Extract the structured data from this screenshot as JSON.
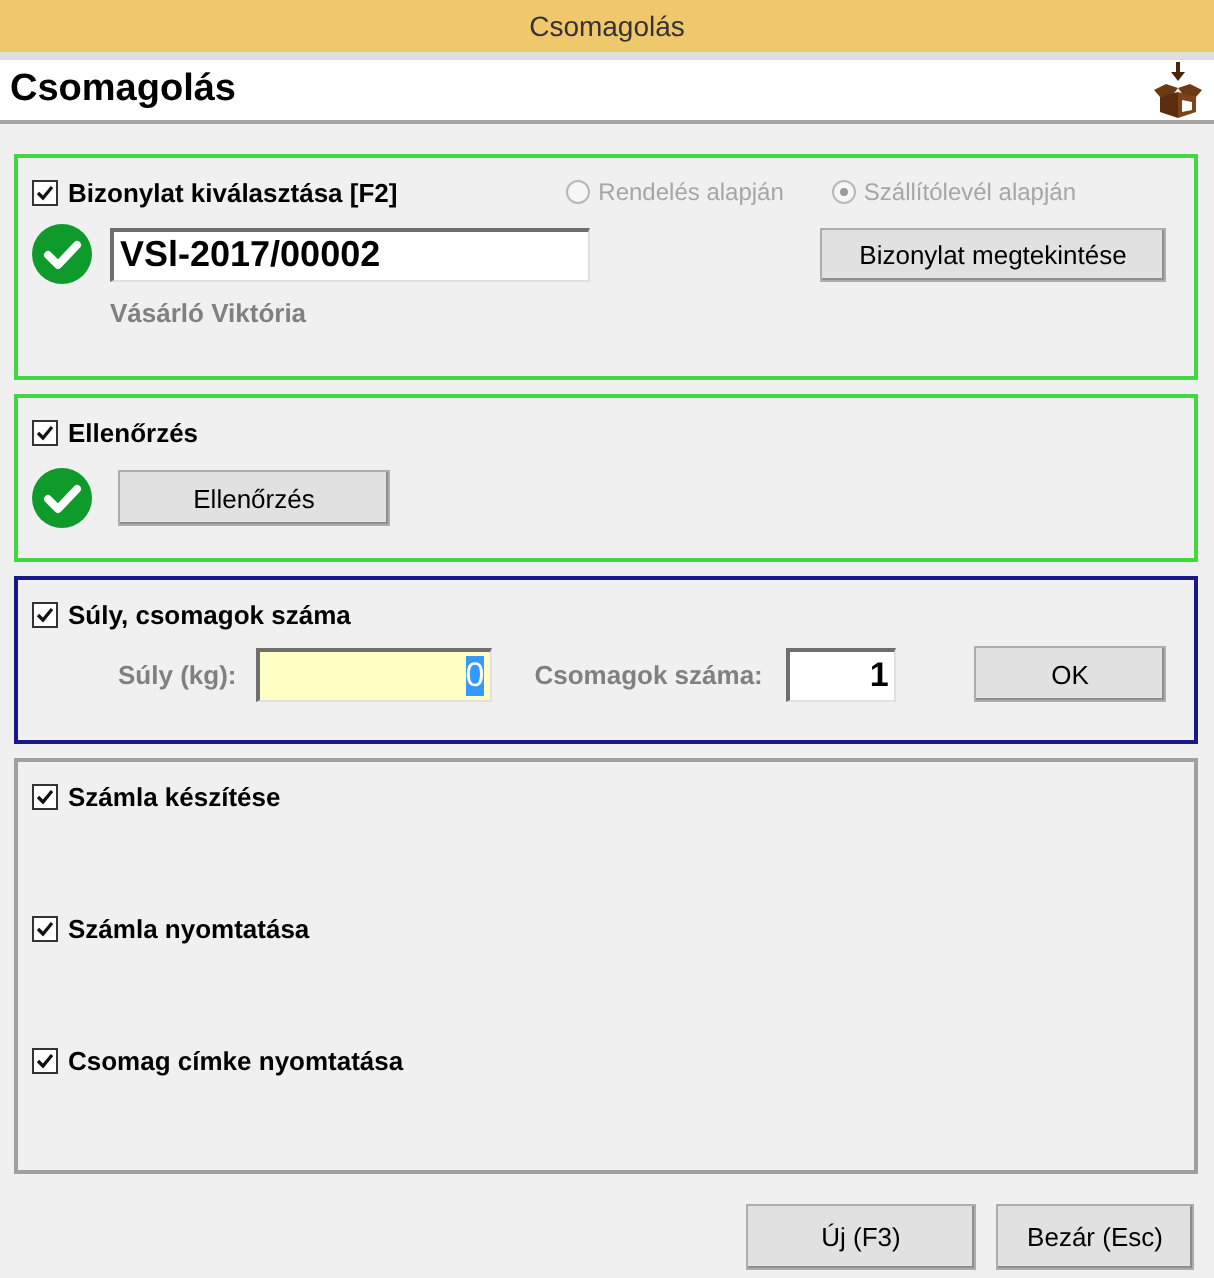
{
  "window": {
    "title": "Csomagolás"
  },
  "header": {
    "title": "Csomagolás"
  },
  "sections": [
    {
      "kind": "document",
      "color": "#40d840",
      "checked": true,
      "label": "Bizonylat kiválasztása [F2]",
      "radios": [
        {
          "label": "Rendelés alapján",
          "selected": false,
          "disabled": true
        },
        {
          "label": "Szállítólevél alapján",
          "selected": true,
          "disabled": true
        }
      ],
      "verified": true,
      "document_field": {
        "value": "VSl-2017/00002"
      },
      "customer": "Vásárló Viktória",
      "button": "Bizonylat megtekintése"
    },
    {
      "kind": "check",
      "color": "#40d840",
      "checked": true,
      "label": "Ellenőrzés",
      "verified": true,
      "button": "Ellenőrzés"
    },
    {
      "kind": "weight",
      "color": "#18188c",
      "checked": true,
      "label": "Súly, csomagok száma",
      "weight": {
        "label": "Súly (kg):",
        "value": "0",
        "text_selected": true
      },
      "packages": {
        "label": "Csomagok száma:",
        "value": "1"
      },
      "button": "OK"
    },
    {
      "kind": "options",
      "color": "#a0a0a0",
      "options": [
        {
          "label": "Számla készítése",
          "checked": true
        },
        {
          "label": "Számla nyomtatása",
          "checked": true
        },
        {
          "label": "Csomag címke nyomtatása",
          "checked": true
        }
      ]
    }
  ],
  "footer_buttons": [
    "Új (F3)",
    "Bezár (Esc)"
  ]
}
